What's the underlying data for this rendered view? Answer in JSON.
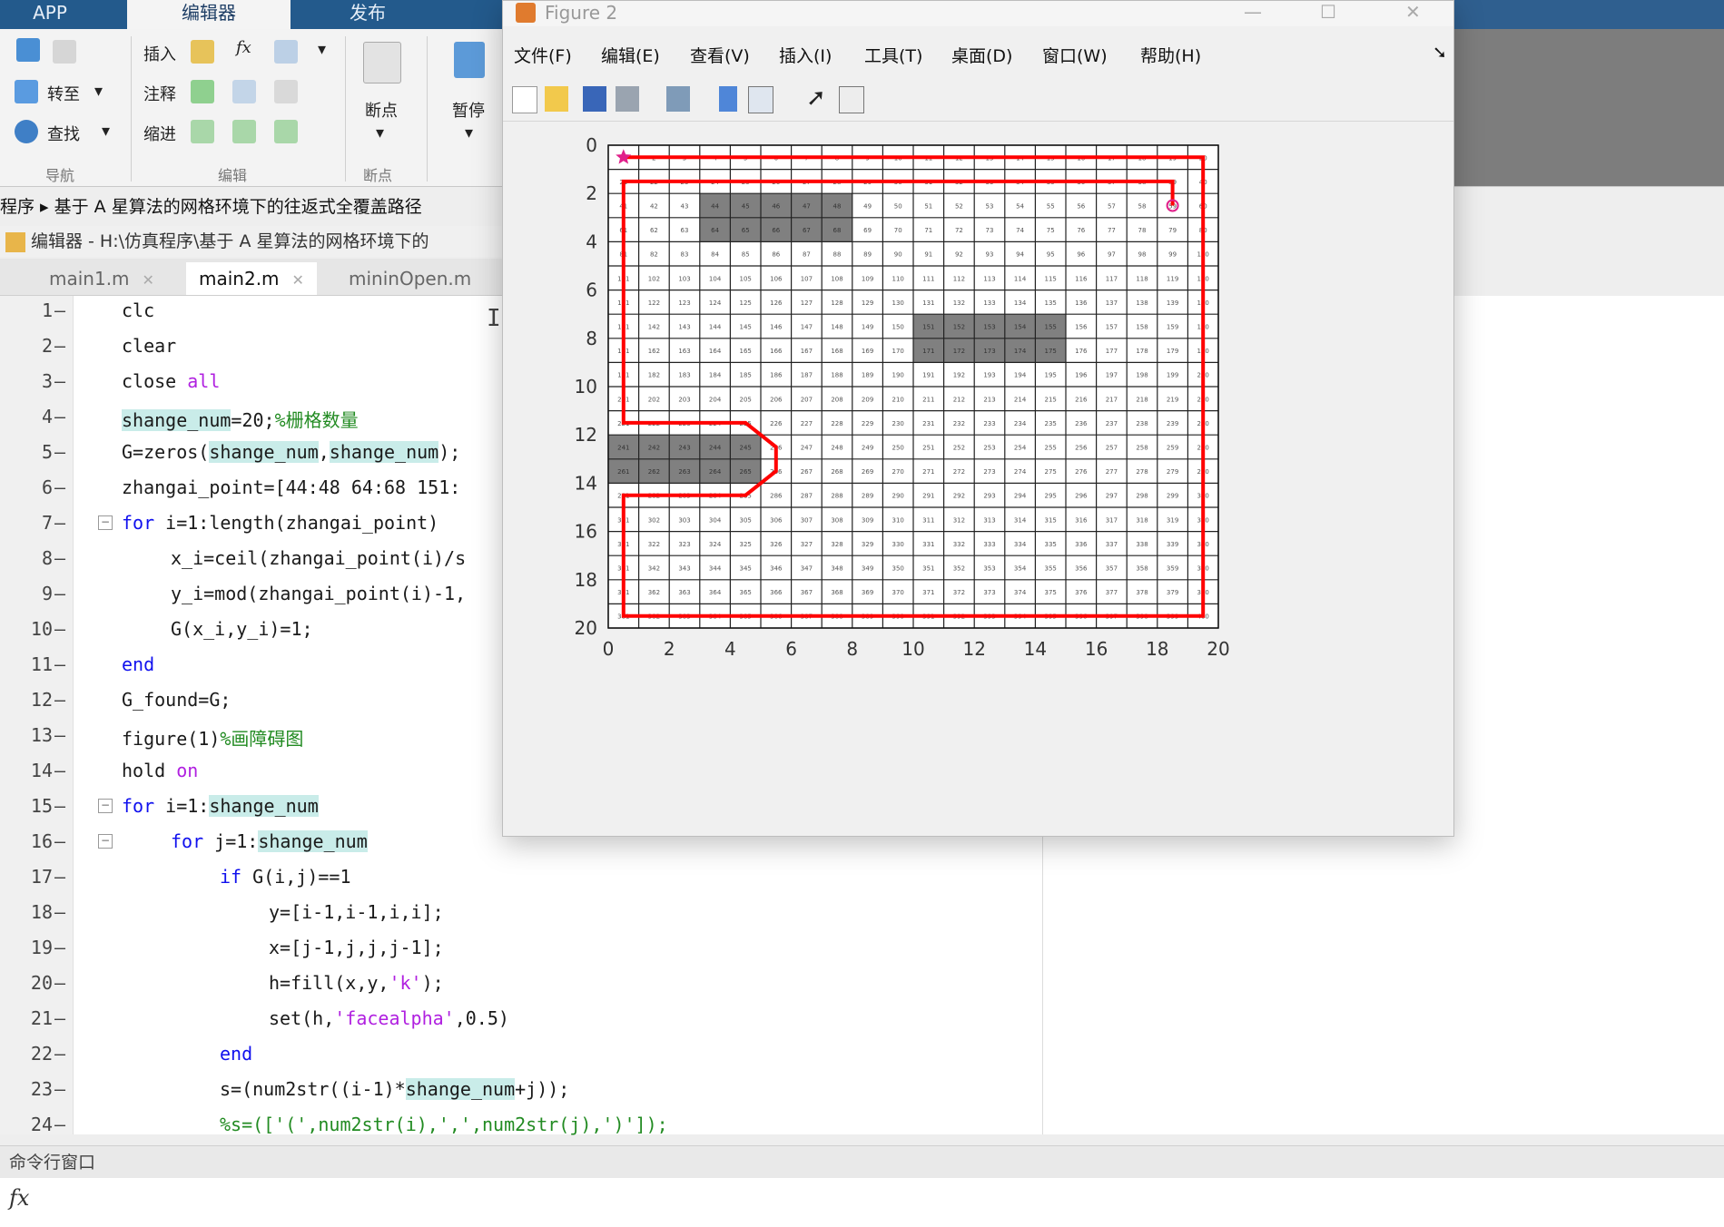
{
  "ribbon": {
    "tabs": [
      "APP",
      "编辑器",
      "发布"
    ],
    "nav_group": {
      "goto": "转至",
      "find": "查找",
      "label": "导航"
    },
    "edit_group": {
      "insert": "插入",
      "comment": "注释",
      "indent": "缩进",
      "label": "编辑"
    },
    "breakpoint_group": {
      "breakpoint": "断点",
      "label": "断点"
    },
    "run_group": {
      "pause": "暂停"
    }
  },
  "editor": {
    "path": "程序 ▸ 基于 A 星算法的网格环境下的往返式全覆盖路径",
    "title": "编辑器 - H:\\仿真程序\\基于 A 星算法的网格环境下的",
    "tabs": [
      {
        "label": "main1.m",
        "active": false
      },
      {
        "label": "main2.m",
        "active": true
      },
      {
        "label": "mininOpen.m",
        "active": false
      }
    ]
  },
  "code_lines": [
    {
      "n": "1",
      "text": "clc"
    },
    {
      "n": "2",
      "text": "clear"
    },
    {
      "n": "3",
      "text": "close all"
    },
    {
      "n": "4",
      "text": "shange_num=20;%栅格数量"
    },
    {
      "n": "5",
      "text": "G=zeros(shange_num,shange_num);"
    },
    {
      "n": "6",
      "text": "zhangai_point=[44:48 64:68 151:"
    },
    {
      "n": "7",
      "text": "for i=1:length(zhangai_point)"
    },
    {
      "n": "8",
      "text": "x_i=ceil(zhangai_point(i)/s"
    },
    {
      "n": "9",
      "text": "y_i=mod(zhangai_point(i)-1,"
    },
    {
      "n": "10",
      "text": "G(x_i,y_i)=1;"
    },
    {
      "n": "11",
      "text": "end"
    },
    {
      "n": "12",
      "text": "G_found=G;"
    },
    {
      "n": "13",
      "text": "figure(1)%画障碍图"
    },
    {
      "n": "14",
      "text": "hold on"
    },
    {
      "n": "15",
      "text": "for i=1:shange_num"
    },
    {
      "n": "16",
      "text": "for j=1:shange_num"
    },
    {
      "n": "17",
      "text": "if G(i,j)==1"
    },
    {
      "n": "18",
      "text": "y=[i-1,i-1,i,i];"
    },
    {
      "n": "19",
      "text": "x=[j-1,j,j,j-1];"
    },
    {
      "n": "20",
      "text": "h=fill(x,y,'k');"
    },
    {
      "n": "21",
      "text": "set(h,'facealpha',0.5)"
    },
    {
      "n": "22",
      "text": "end"
    },
    {
      "n": "23",
      "text": "s=(num2str((i-1)*shange_num+j));"
    },
    {
      "n": "24",
      "text": "%s=(['(',num2str(i),',',num2str(j),')']);"
    }
  ],
  "command_window": {
    "title": "命令行窗口",
    "prompt": "fx"
  },
  "figure": {
    "title": "Figure 2",
    "menu": [
      "文件(F)",
      "编辑(E)",
      "查看(V)",
      "插入(I)",
      "工具(T)",
      "桌面(D)",
      "窗口(W)",
      "帮助(H)"
    ],
    "toolbar_icons": [
      "new-file-icon",
      "open-icon",
      "save-icon",
      "print-icon",
      "zoom-figure-icon",
      "colorbar-icon",
      "legend-icon",
      "pointer-icon",
      "property-icon"
    ]
  },
  "chart_data": {
    "type": "line",
    "title": "",
    "xlabel": "",
    "ylabel": "",
    "xlim": [
      0,
      20
    ],
    "ylim": [
      0,
      20
    ],
    "y_reversed": true,
    "grid": true,
    "x_ticks": [
      0,
      2,
      4,
      6,
      8,
      10,
      12,
      14,
      16,
      18,
      20
    ],
    "y_ticks": [
      0,
      2,
      4,
      6,
      8,
      10,
      12,
      14,
      16,
      18,
      20
    ],
    "grid_size": 20,
    "obstacles": [
      44,
      45,
      46,
      47,
      48,
      64,
      65,
      66,
      67,
      68,
      151,
      152,
      153,
      154,
      155,
      171,
      172,
      173,
      174,
      175,
      241,
      242,
      243,
      244,
      245,
      261,
      262,
      263,
      264,
      265
    ],
    "start_marker": {
      "x": 0.5,
      "y": 0.5,
      "shape": "star",
      "color": "#e0208a"
    },
    "end_marker": {
      "x": 18.5,
      "y": 2.5,
      "shape": "circle",
      "color": "#e0208a"
    },
    "path_color": "#ff0000",
    "series": [
      {
        "x": [
          0.5,
          19.5,
          19.5,
          0.5,
          0.5,
          4.5,
          5.5,
          5.5,
          4.5,
          0.5,
          0.5,
          18.5,
          18.5
        ],
        "y": [
          0.5,
          0.5,
          19.5,
          19.5,
          14.5,
          14.5,
          13.5,
          12.5,
          11.5,
          11.5,
          1.5,
          1.5,
          2.5
        ]
      }
    ]
  }
}
